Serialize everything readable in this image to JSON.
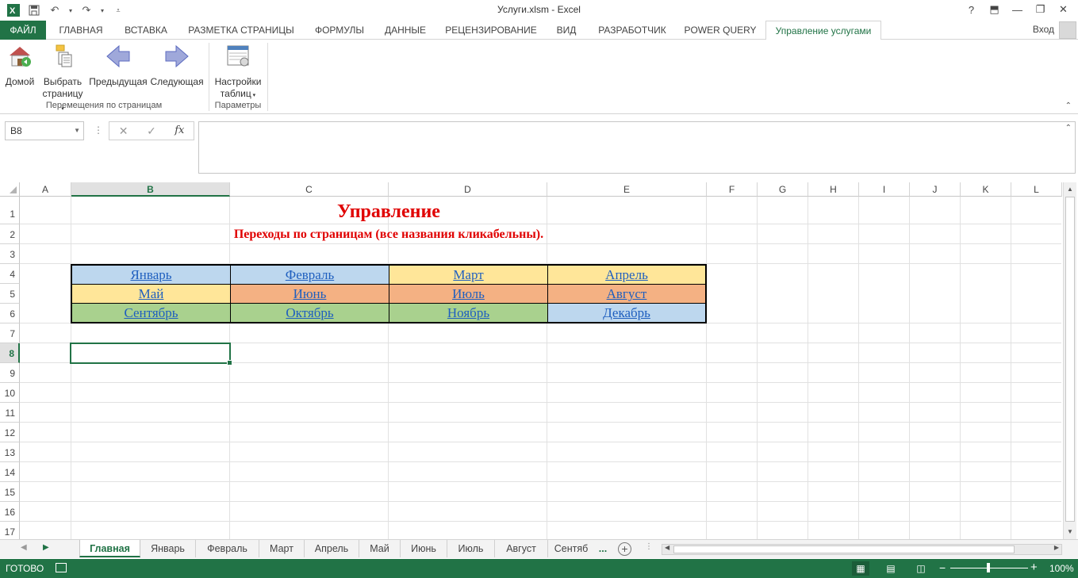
{
  "window": {
    "title": "Услуги.xlsm - Excel",
    "controls": [
      "?",
      "⬒",
      "—",
      "❐",
      "✕"
    ]
  },
  "tabs": [
    "ФАЙЛ",
    "ГЛАВНАЯ",
    "ВСТАВКА",
    "РАЗМЕТКА СТРАНИЦЫ",
    "ФОРМУЛЫ",
    "ДАННЫЕ",
    "РЕЦЕНЗИРОВАНИЕ",
    "ВИД",
    "РАЗРАБОТЧИК",
    "POWER QUERY",
    "Управление услугами"
  ],
  "active_tab": "Управление услугами",
  "login": "Вход",
  "ribbon": {
    "home": "Домой",
    "choose_line1": "Выбрать",
    "choose_line2": "страницу",
    "prev": "Предыдущая",
    "next": "Следующая",
    "group_nav": "Перемещения по страницам",
    "settings_line1": "Настройки",
    "settings_line2": "таблиц",
    "group_params": "Параметры"
  },
  "formula_bar": {
    "namebox": "B8",
    "fx": "fx",
    "content": ""
  },
  "grid": {
    "columns": [
      "A",
      "B",
      "C",
      "D",
      "E",
      "F",
      "G",
      "H",
      "I",
      "J",
      "K",
      "L"
    ],
    "selected_column": "B",
    "rows": [
      "1",
      "2",
      "3",
      "4",
      "5",
      "6",
      "7",
      "8",
      "9",
      "10",
      "11",
      "12",
      "13",
      "14",
      "15",
      "16",
      "17"
    ],
    "selected_row": "8"
  },
  "sheet": {
    "title": "Управление",
    "subtitle": "Переходы по страницам (все названия кликабельны).",
    "months": [
      {
        "label": "Январь",
        "color": "#bdd7ee"
      },
      {
        "label": "Февраль",
        "color": "#bdd7ee"
      },
      {
        "label": "Март",
        "color": "#ffe699"
      },
      {
        "label": "Апрель",
        "color": "#ffe699"
      },
      {
        "label": "Май",
        "color": "#ffe699"
      },
      {
        "label": "Июнь",
        "color": "#f4b183"
      },
      {
        "label": "Июль",
        "color": "#f4b183"
      },
      {
        "label": "Август",
        "color": "#f4b183"
      },
      {
        "label": "Сентябрь",
        "color": "#a9d18e"
      },
      {
        "label": "Октябрь",
        "color": "#a9d18e"
      },
      {
        "label": "Ноябрь",
        "color": "#a9d18e"
      },
      {
        "label": "Декабрь",
        "color": "#bdd7ee"
      }
    ]
  },
  "sheet_tabs": [
    "Главная",
    "Январь",
    "Февраль",
    "Март",
    "Апрель",
    "Май",
    "Июнь",
    "Июль",
    "Август",
    "Сентяб"
  ],
  "sheet_tabs_more": "...",
  "status": {
    "ready": "ГОТОВО",
    "zoom": "100%"
  },
  "colors": {
    "excel_green": "#217346",
    "title_red": "#e00000",
    "link_blue": "#1f5fbf"
  }
}
